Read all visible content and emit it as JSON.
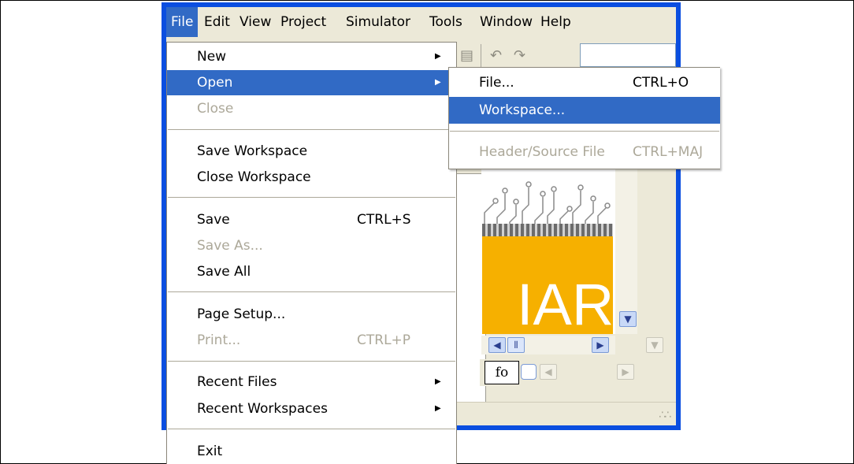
{
  "menubar": {
    "items": [
      "File",
      "Edit",
      "View",
      "Project",
      "Simulator",
      "Tools",
      "Window",
      "Help"
    ],
    "active": "File"
  },
  "file_menu": {
    "new": "New",
    "open": "Open",
    "close": "Close",
    "save_workspace": "Save Workspace",
    "close_workspace": "Close Workspace",
    "save": "Save",
    "save_shortcut": "CTRL+S",
    "save_as": "Save As...",
    "save_all": "Save All",
    "page_setup": "Page Setup...",
    "print": "Print...",
    "print_shortcut": "CTRL+P",
    "recent_files": "Recent Files",
    "recent_workspaces": "Recent Workspaces",
    "exit": "Exit"
  },
  "open_submenu": {
    "file": "File...",
    "file_shortcut": "CTRL+O",
    "workspace": "Workspace...",
    "header_source": "Header/Source File",
    "header_source_shortcut": "CTRL+MAJ"
  },
  "workspace": {
    "logo_text": "IAR",
    "tab_label": "fo"
  },
  "colors": {
    "selection": "#316ac5",
    "window_frame": "#0a4ee0",
    "chrome": "#ece9d8",
    "disabled_text": "#aca899",
    "logo_orange": "#f6b000"
  }
}
